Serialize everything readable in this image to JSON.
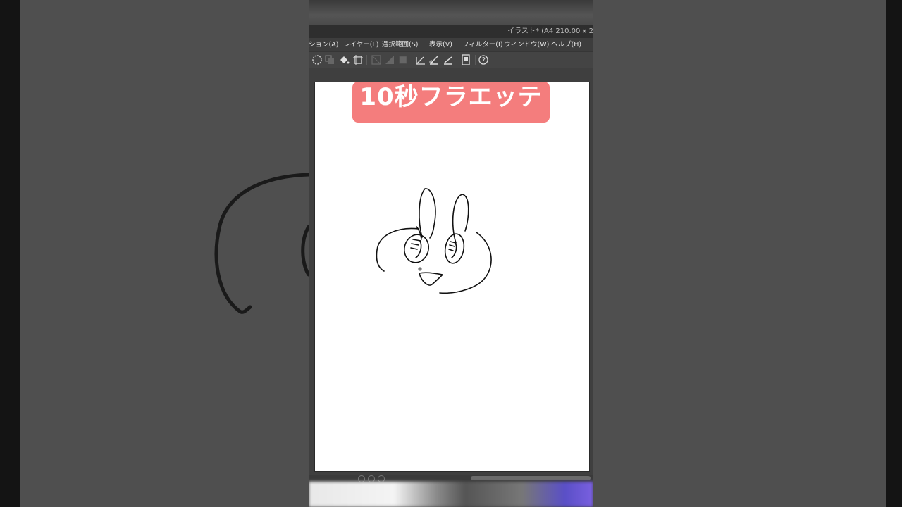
{
  "app": {
    "window_title": "イラスト* (A4 210.00 x 2",
    "menus": [
      "ション(A)",
      "レイヤー(L)",
      "選択範囲(S)",
      "表示(V)",
      "フィルター(I)",
      "ウィンドウ(W)",
      "ヘルプ(H)"
    ],
    "toolbar_icons": [
      "lasso-select-icon",
      "copy-layer-icon",
      "fill-bucket-icon",
      "transform-icon",
      "clear-icon",
      "shape-icon",
      "square-icon",
      "ruler-icon",
      "pen-icon",
      "brush-icon",
      "page-icon",
      "settings-icon"
    ]
  },
  "overlay": {
    "caption": "10秒フラエッテ"
  },
  "colors": {
    "caption_bg": "#f47d7d",
    "background": "#4f4f4f",
    "panel": "#3b3b3b"
  }
}
